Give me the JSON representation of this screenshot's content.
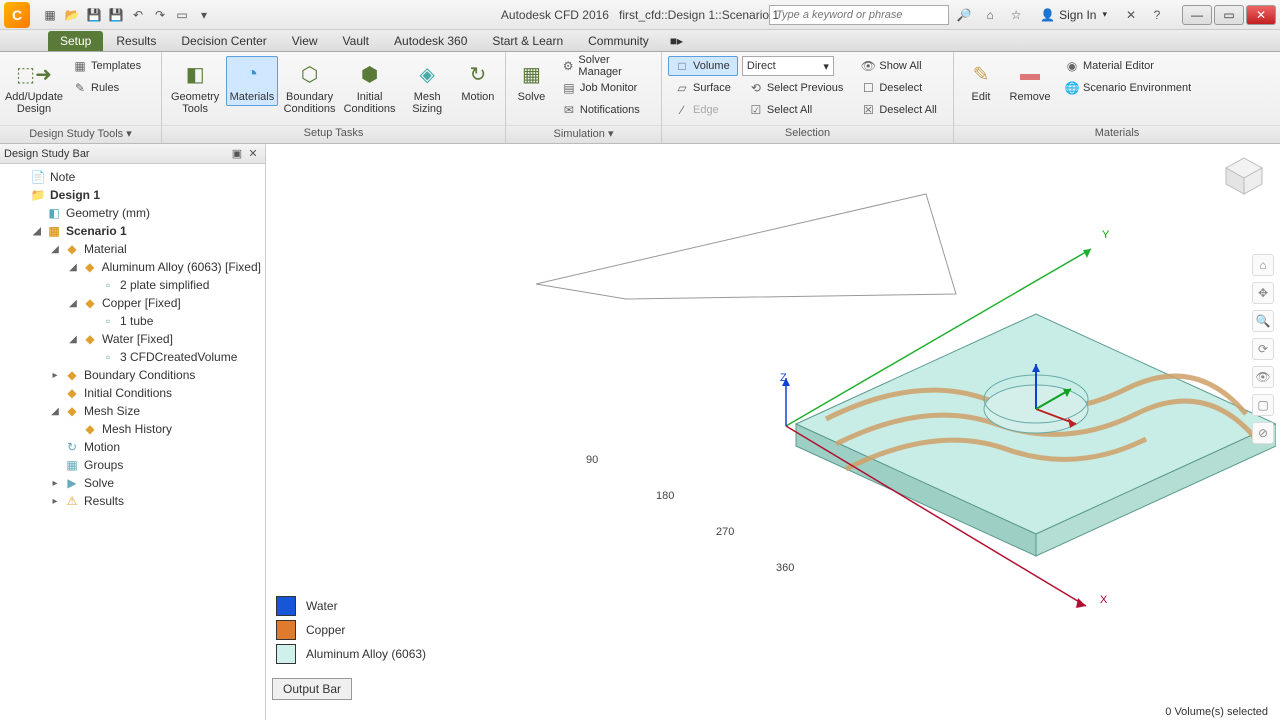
{
  "title": {
    "app": "Autodesk CFD 2016",
    "doc": "first_cfd::Design 1::Scenario 1"
  },
  "search_placeholder": "Type a keyword or phrase",
  "signin": "Sign In",
  "tabs": [
    "Setup",
    "Results",
    "Decision Center",
    "View",
    "Vault",
    "Autodesk 360",
    "Start & Learn",
    "Community"
  ],
  "ribbon": {
    "group1_label": "Design Study Tools ▾",
    "add_update": "Add/Update Design",
    "templates": "Templates",
    "rules": "Rules",
    "group2_label": "Setup Tasks",
    "geometry_tools": "Geometry Tools",
    "materials": "Materials",
    "boundary": "Boundary Conditions",
    "initial": "Initial Conditions",
    "mesh": "Mesh Sizing",
    "motion": "Motion",
    "group3_label": "Simulation ▾",
    "solve": "Solve",
    "solver_mgr": "Solver Manager",
    "job_monitor": "Job Monitor",
    "notifications": "Notifications",
    "group4_label": "Selection",
    "volume": "Volume",
    "surface": "Surface",
    "edge": "Edge",
    "direct": "Direct",
    "select_prev": "Select Previous",
    "select_all": "Select All",
    "show_all": "Show All",
    "deselect": "Deselect",
    "deselect_all": "Deselect All",
    "group5_label": "Materials",
    "edit": "Edit",
    "remove": "Remove",
    "mat_editor": "Material Editor",
    "scenario_env": "Scenario Environment"
  },
  "dsb_title": "Design Study Bar",
  "tree": {
    "note": "Note",
    "design": "Design 1",
    "geometry": "Geometry (mm)",
    "scenario": "Scenario 1",
    "material": "Material",
    "al": "Aluminum Alloy (6063) [Fixed]",
    "al_part": "2 plate simplified",
    "cu": "Copper [Fixed]",
    "cu_part": "1 tube",
    "water": "Water [Fixed]",
    "water_part": "3 CFDCreatedVolume",
    "bc": "Boundary Conditions",
    "ic": "Initial Conditions",
    "mesh": "Mesh Size",
    "mesh_hist": "Mesh History",
    "motion": "Motion",
    "groups": "Groups",
    "solve": "Solve",
    "results": "Results"
  },
  "legend": {
    "water": "Water",
    "water_c": "#1557d6",
    "copper": "Copper",
    "copper_c": "#e07a2c",
    "al": "Aluminum Alloy (6063)",
    "al_c": "#d0f0ec"
  },
  "output_bar": "Output Bar",
  "status": "0 Volume(s) selected",
  "axes": {
    "x": "X",
    "y": "Y",
    "z": "Z",
    "ticks": [
      "90",
      "180",
      "270",
      "360"
    ]
  }
}
